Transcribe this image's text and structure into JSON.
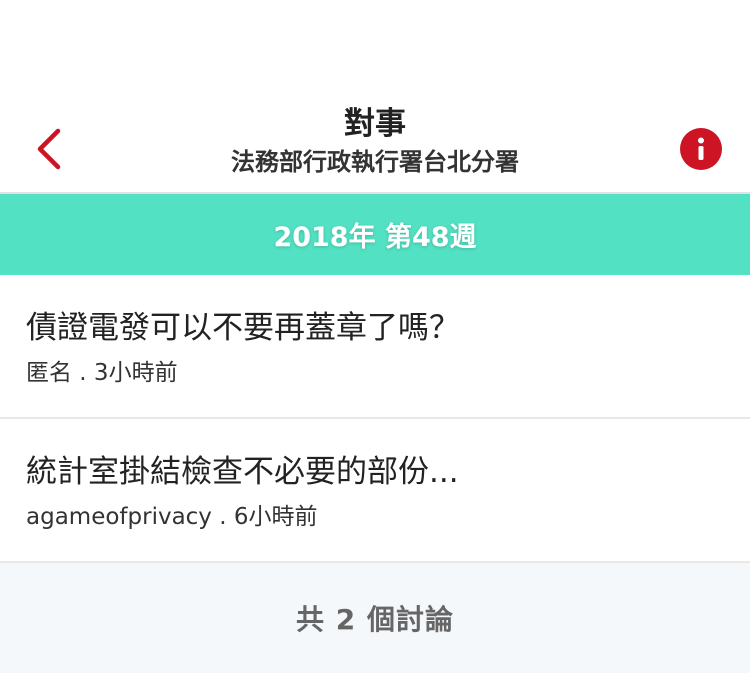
{
  "header": {
    "title": "對事",
    "subtitle": "法務部行政執行署台北分署"
  },
  "week": {
    "label": "2018年 第48週"
  },
  "posts": [
    {
      "title": "債證電發可以不要再蓋章了嗎？",
      "meta": "匿名 . 3小時前"
    },
    {
      "title": "統計室掛結檢查不必要的部份...",
      "meta": "agameofprivacy . 6小時前"
    }
  ],
  "footer": {
    "count_text": "共 2 個討論"
  },
  "colors": {
    "accent_red": "#cc1424",
    "banner_teal": "#52e1c3",
    "footer_bg": "#f5f8fb"
  },
  "icons": {
    "back": "chevron-left-icon",
    "info": "info-icon"
  }
}
